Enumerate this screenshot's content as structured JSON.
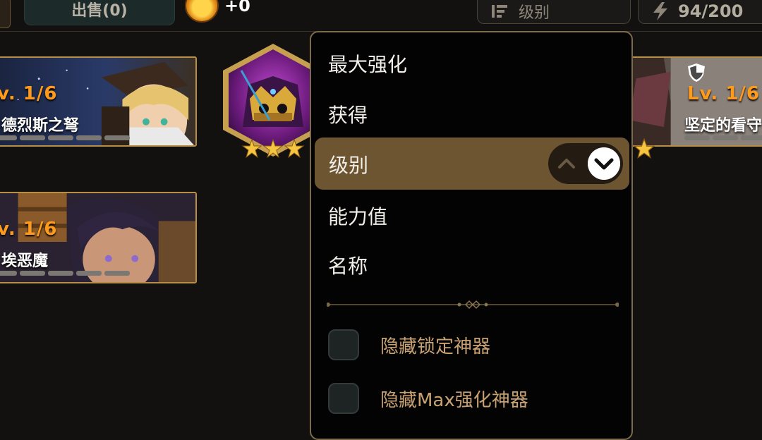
{
  "topbar": {
    "sell_label": "出售",
    "sell_count": "(0)",
    "coin_value": "+0",
    "sort_label": "级别",
    "energy_value": "94/200"
  },
  "cards": [
    {
      "level": "v. 1/6",
      "name": "德烈斯之弩",
      "pips": 5
    },
    {
      "level": "v. 1/6",
      "name": "埃恶魔",
      "pips": 5
    },
    {
      "level": "Lv. 1/6",
      "name": "坚定的看守",
      "pips": 5
    }
  ],
  "hex_artifact": {
    "stars": 3
  },
  "sort_menu": {
    "options": [
      "最大强化",
      "获得",
      "级别",
      "能力值",
      "名称"
    ],
    "selected_index": 2,
    "filters": [
      "隐藏锁定神器",
      "隐藏Max强化神器"
    ]
  },
  "colors": {
    "accent_gold": "#b78f47",
    "selected_row": "#6e5531",
    "level_orange": "#ff9a1a",
    "filter_text": "#c9a273"
  }
}
